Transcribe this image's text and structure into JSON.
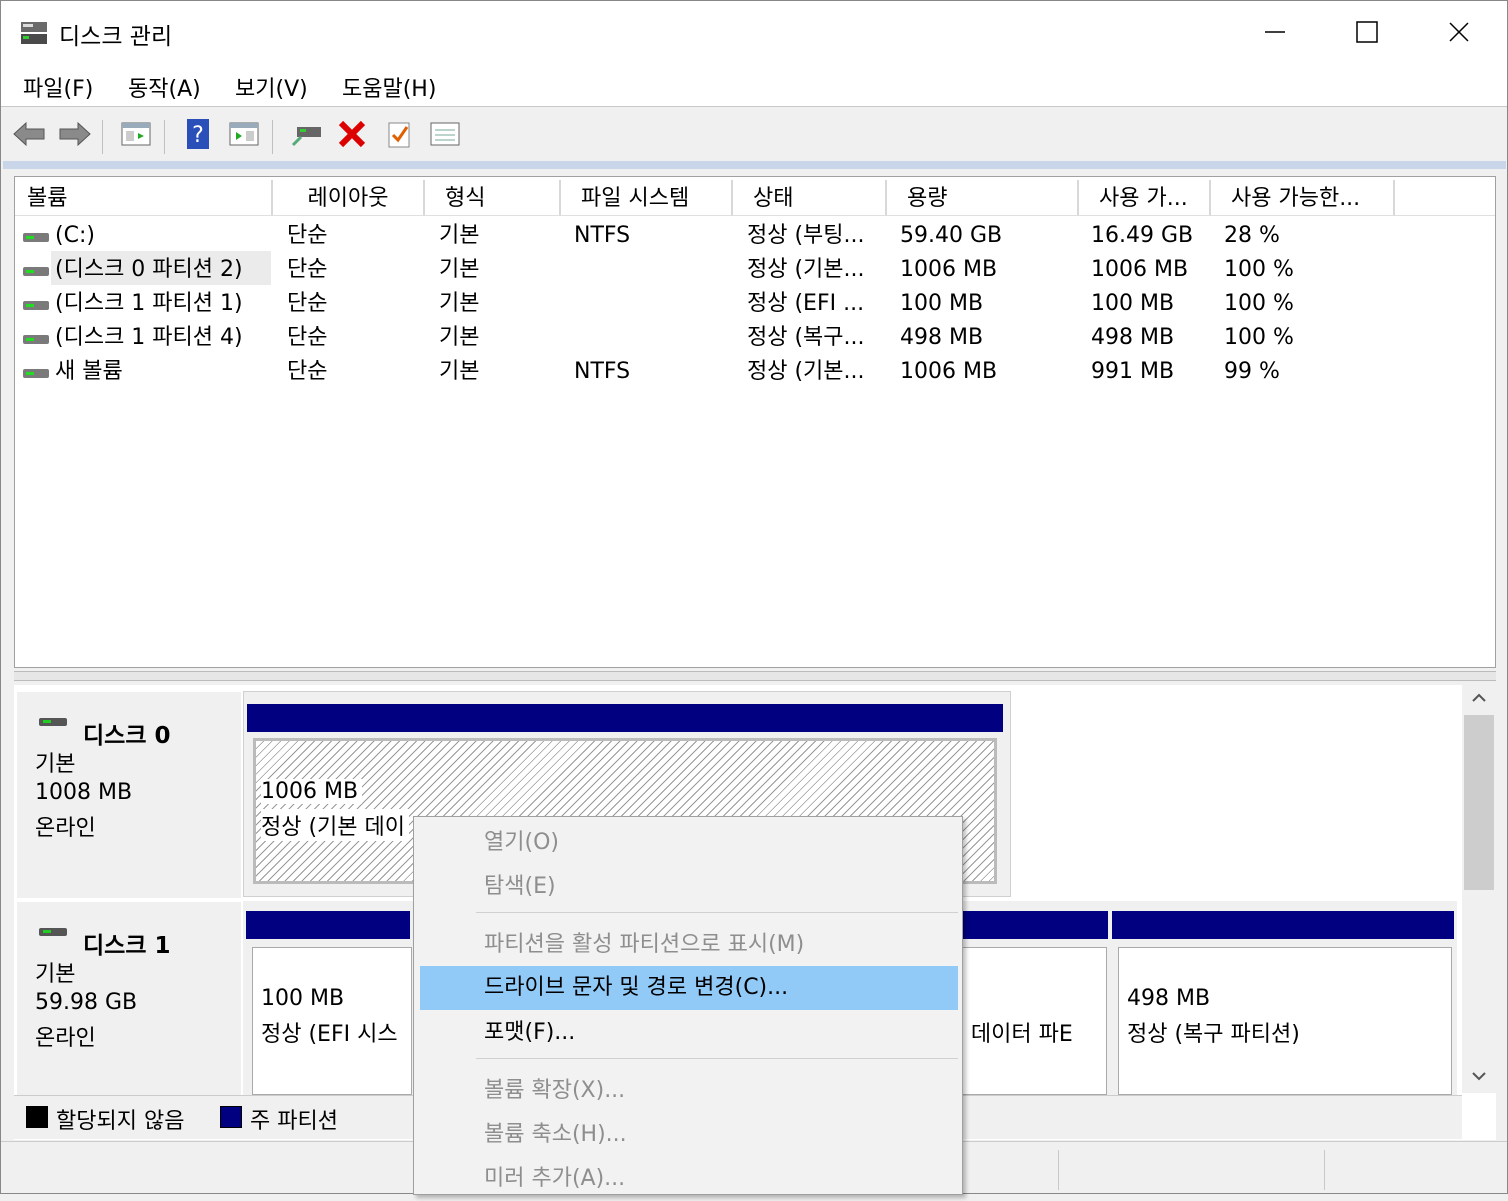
{
  "window": {
    "title": "디스크 관리",
    "controls": {
      "minimize": "—",
      "maximize": "☐",
      "close": "✕"
    }
  },
  "menu": [
    "파일(F)",
    "동작(A)",
    "보기(V)",
    "도움말(H)"
  ],
  "toolbar": {
    "icons": [
      "back-arrow-icon",
      "forward-arrow-icon",
      "console-tree-icon",
      "help-icon",
      "show-pane-icon",
      "connect-drive-icon",
      "delete-icon",
      "check-icon",
      "properties-icon"
    ]
  },
  "volume_list": {
    "columns": [
      "볼륨",
      "레이아웃",
      "형식",
      "파일 시스템",
      "상태",
      "용량",
      "사용 가...",
      "사용 가능한..."
    ],
    "rows": [
      {
        "volume": " (C:)",
        "layout": "단순",
        "type": "기본",
        "fs": "NTFS",
        "status": "정상 (부팅...",
        "capacity": "59.40 GB",
        "free": "16.49 GB",
        "pct": "28 %"
      },
      {
        "volume": "(디스크 0 파티션 2)",
        "layout": "단순",
        "type": "기본",
        "fs": "",
        "status": "정상 (기본...",
        "capacity": "1006 MB",
        "free": "1006 MB",
        "pct": "100 %"
      },
      {
        "volume": "(디스크 1 파티션 1)",
        "layout": "단순",
        "type": "기본",
        "fs": "",
        "status": "정상 (EFI ...",
        "capacity": "100 MB",
        "free": "100 MB",
        "pct": "100 %"
      },
      {
        "volume": "(디스크 1 파티션 4)",
        "layout": "단순",
        "type": "기본",
        "fs": "",
        "status": "정상 (복구...",
        "capacity": "498 MB",
        "free": "498 MB",
        "pct": "100 %"
      },
      {
        "volume": "새 볼륨",
        "layout": "단순",
        "type": "기본",
        "fs": "NTFS",
        "status": "정상 (기본...",
        "capacity": "1006 MB",
        "free": "991 MB",
        "pct": "99 %"
      }
    ]
  },
  "disks": [
    {
      "name": "디스크 0",
      "type": "기본",
      "size": "1008 MB",
      "state": "온라인",
      "partitions": [
        {
          "size": "1006 MB",
          "status": "정상 (기본 데이"
        }
      ]
    },
    {
      "name": "디스크 1",
      "type": "기본",
      "size": "59.98 GB",
      "state": "온라인",
      "partitions": [
        {
          "size": "100 MB",
          "status": "정상 (EFI 시스"
        },
        {
          "size": "",
          "status": "- 데이터 파E"
        },
        {
          "size": "498 MB",
          "status": "정상 (복구 파티션)"
        }
      ]
    }
  ],
  "legend": [
    {
      "label": "할당되지 않음",
      "color": "#000000"
    },
    {
      "label": "주 파티션",
      "color": "#000080"
    }
  ],
  "context_menu": {
    "items": [
      {
        "label": "열기(O)",
        "disabled": true
      },
      {
        "label": "탐색(E)",
        "disabled": true
      },
      {
        "label": "파티션을 활성 파티션으로 표시(M)",
        "disabled": true
      },
      {
        "label": "드라이브 문자 및 경로 변경(C)...",
        "disabled": false,
        "highlighted": true
      },
      {
        "label": "포맷(F)...",
        "disabled": false
      },
      {
        "label": "볼륨 확장(X)...",
        "disabled": true
      },
      {
        "label": "볼륨 축소(H)...",
        "disabled": true
      },
      {
        "label": "미러 추가(A)...",
        "disabled": true
      }
    ]
  },
  "colors": {
    "primary_partition": "#000080",
    "highlight": "#91c9f7",
    "accent_blue_line": "#c9d6ea"
  }
}
